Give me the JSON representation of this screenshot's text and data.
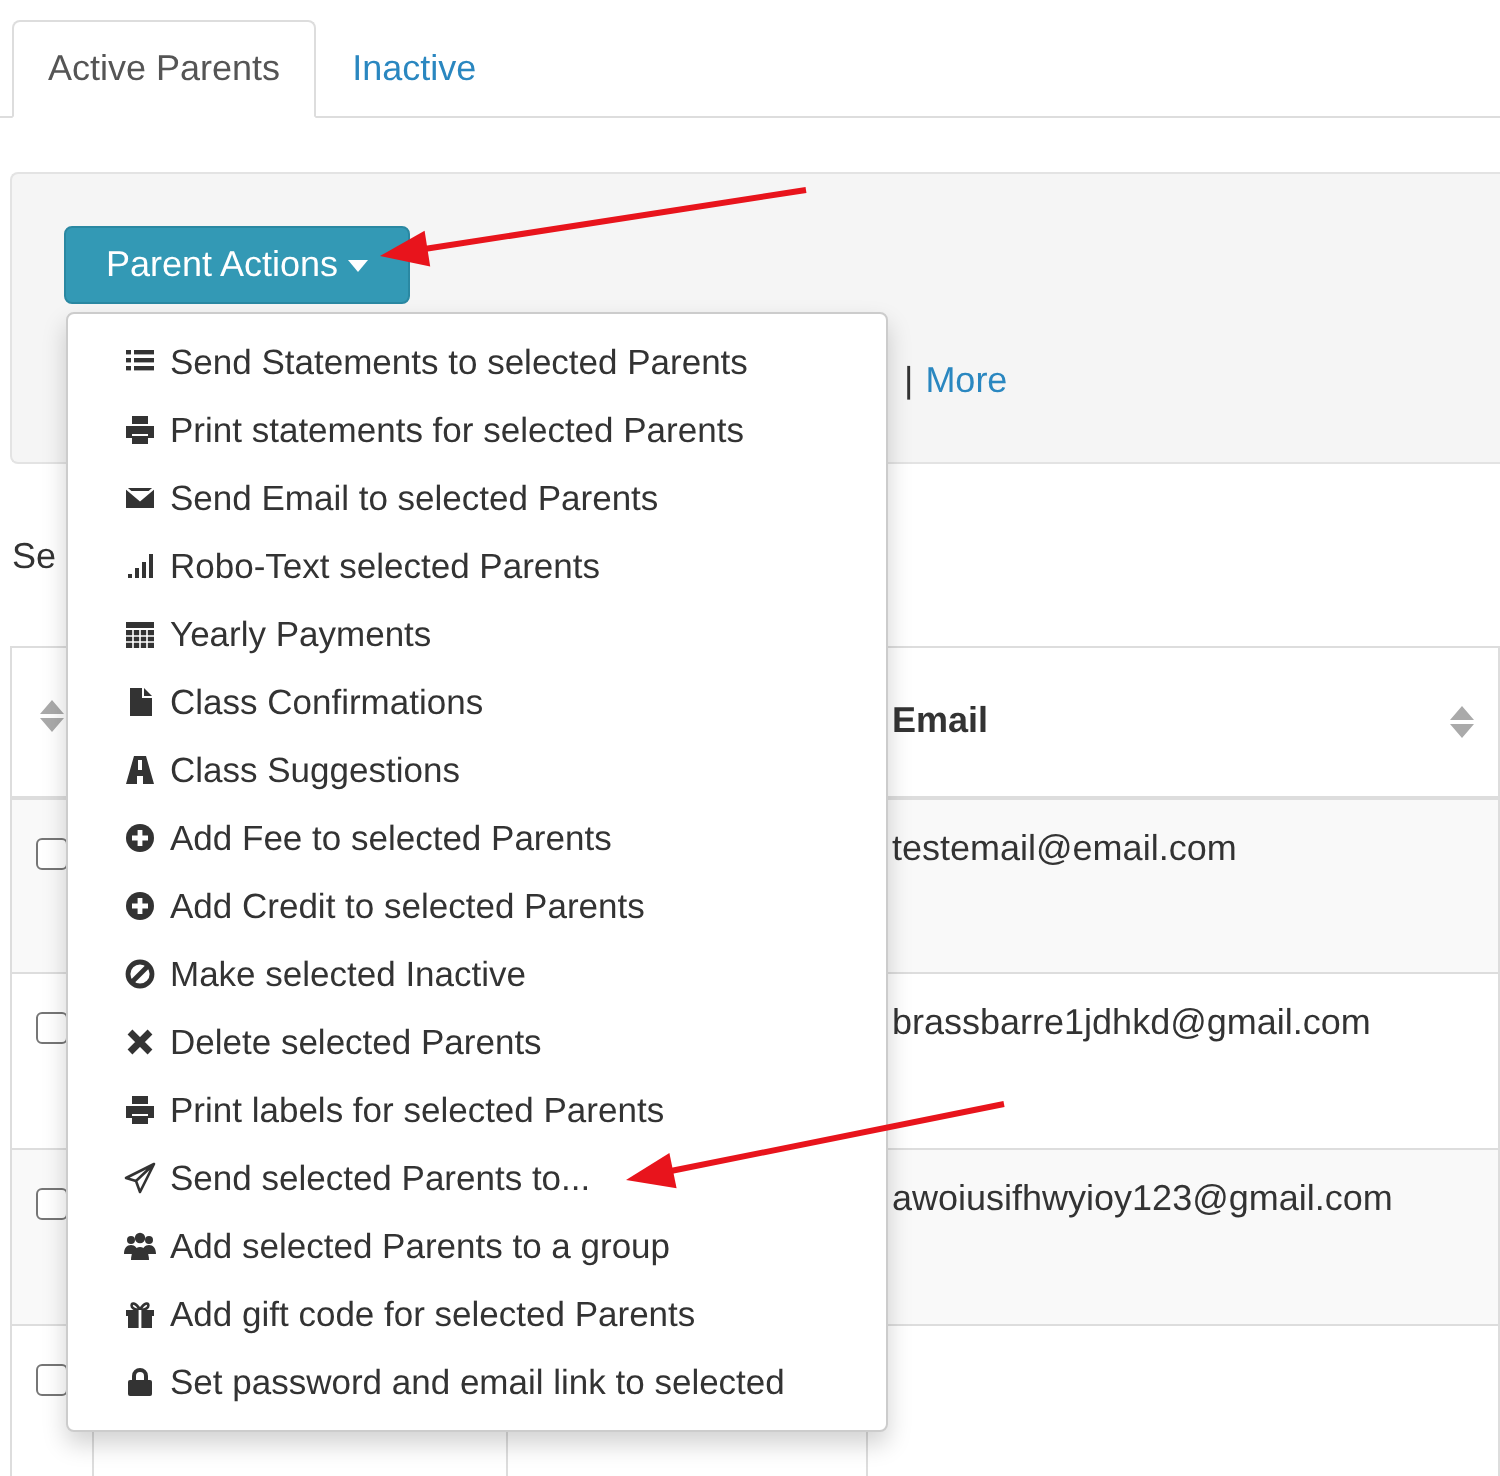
{
  "tabs": [
    {
      "label": "Active Parents",
      "selected": true
    },
    {
      "label": "Inactive",
      "selected": false
    }
  ],
  "actions_button": {
    "label": "Parent Actions"
  },
  "panel_links": {
    "separator": "|",
    "more": "More"
  },
  "search_label": "Se",
  "table": {
    "email_column": "Email",
    "rows": [
      {
        "checked": false,
        "email": "testemail@email.com"
      },
      {
        "checked": false,
        "email": "brassbarre1jdhkd@gmail.com"
      },
      {
        "checked": false,
        "email": "awoiusifhwyioy123@gmail.com"
      },
      {
        "checked": false
      }
    ]
  },
  "menu": [
    {
      "label": "Send Statements to selected Parents"
    },
    {
      "label": "Print statements for selected Parents"
    },
    {
      "label": "Send Email to selected Parents"
    },
    {
      "label": "Robo-Text selected Parents"
    },
    {
      "label": "Yearly Payments"
    },
    {
      "label": "Class Confirmations"
    },
    {
      "label": "Class Suggestions"
    },
    {
      "label": "Add Fee to selected Parents"
    },
    {
      "label": "Add Credit to selected Parents"
    },
    {
      "label": "Make selected Inactive"
    },
    {
      "label": "Delete selected Parents"
    },
    {
      "label": "Print labels for selected Parents"
    },
    {
      "label": "Send selected Parents to..."
    },
    {
      "label": "Add selected Parents to a group"
    },
    {
      "label": "Add gift code for selected Parents"
    },
    {
      "label": "Set password and email link to selected"
    }
  ]
}
